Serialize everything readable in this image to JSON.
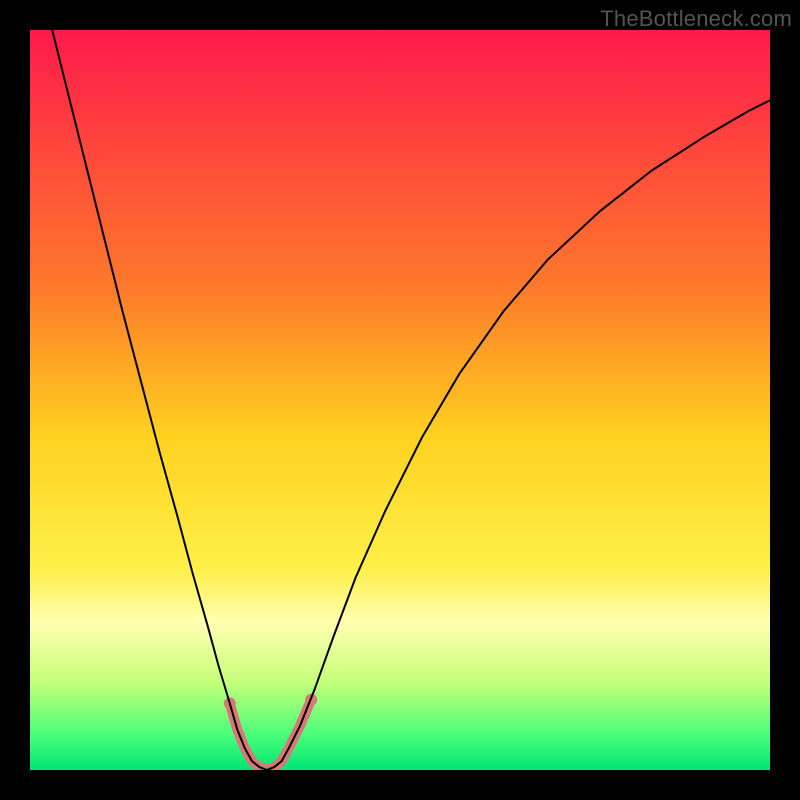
{
  "watermark": "TheBottleneck.com",
  "chart_data": {
    "type": "line",
    "title": "",
    "xlabel": "",
    "ylabel": "",
    "xlim": [
      0,
      100
    ],
    "ylim": [
      0,
      100
    ],
    "background_gradient": {
      "stops": [
        {
          "offset": 0,
          "color": "#ff1a4b"
        },
        {
          "offset": 35,
          "color": "#ff7a2a"
        },
        {
          "offset": 55,
          "color": "#ffd21f"
        },
        {
          "offset": 73,
          "color": "#fff04a"
        },
        {
          "offset": 80,
          "color": "#ffffb0"
        },
        {
          "offset": 88,
          "color": "#c7ff7a"
        },
        {
          "offset": 95,
          "color": "#4dff7a"
        },
        {
          "offset": 100,
          "color": "#00e676"
        }
      ]
    },
    "series": [
      {
        "name": "bottleneck-curve",
        "stroke": "#000000",
        "stroke_width": 2,
        "points": [
          {
            "x": 3.0,
            "y": 100.0
          },
          {
            "x": 5.0,
            "y": 92.0
          },
          {
            "x": 7.5,
            "y": 82.0
          },
          {
            "x": 10.0,
            "y": 72.0
          },
          {
            "x": 12.5,
            "y": 62.0
          },
          {
            "x": 15.0,
            "y": 52.5
          },
          {
            "x": 17.5,
            "y": 43.0
          },
          {
            "x": 20.0,
            "y": 34.0
          },
          {
            "x": 22.0,
            "y": 26.5
          },
          {
            "x": 24.0,
            "y": 19.5
          },
          {
            "x": 25.5,
            "y": 14.0
          },
          {
            "x": 27.0,
            "y": 9.0
          },
          {
            "x": 28.0,
            "y": 5.5
          },
          {
            "x": 29.0,
            "y": 3.0
          },
          {
            "x": 30.0,
            "y": 1.2
          },
          {
            "x": 31.0,
            "y": 0.4
          },
          {
            "x": 32.0,
            "y": 0.0
          },
          {
            "x": 33.0,
            "y": 0.4
          },
          {
            "x": 34.0,
            "y": 1.2
          },
          {
            "x": 35.0,
            "y": 3.0
          },
          {
            "x": 36.5,
            "y": 6.0
          },
          {
            "x": 38.5,
            "y": 11.0
          },
          {
            "x": 41.0,
            "y": 18.0
          },
          {
            "x": 44.0,
            "y": 26.0
          },
          {
            "x": 48.0,
            "y": 35.0
          },
          {
            "x": 53.0,
            "y": 45.0
          },
          {
            "x": 58.0,
            "y": 53.5
          },
          {
            "x": 64.0,
            "y": 62.0
          },
          {
            "x": 70.0,
            "y": 69.0
          },
          {
            "x": 77.0,
            "y": 75.5
          },
          {
            "x": 84.0,
            "y": 81.0
          },
          {
            "x": 91.0,
            "y": 85.5
          },
          {
            "x": 97.0,
            "y": 89.0
          },
          {
            "x": 100.0,
            "y": 90.5
          }
        ]
      },
      {
        "name": "highlight-segment",
        "stroke": "#d97777",
        "stroke_width": 10,
        "linecap": "round",
        "dots": true,
        "dot_radius": 6,
        "points": [
          {
            "x": 27.0,
            "y": 9.0
          },
          {
            "x": 28.0,
            "y": 5.5
          },
          {
            "x": 29.0,
            "y": 3.0
          },
          {
            "x": 30.0,
            "y": 1.2
          },
          {
            "x": 31.0,
            "y": 0.4
          },
          {
            "x": 32.0,
            "y": 0.0
          },
          {
            "x": 33.0,
            "y": 0.4
          },
          {
            "x": 34.0,
            "y": 1.2
          },
          {
            "x": 35.0,
            "y": 3.0
          },
          {
            "x": 36.5,
            "y": 6.0
          },
          {
            "x": 38.0,
            "y": 9.5
          }
        ]
      }
    ]
  }
}
